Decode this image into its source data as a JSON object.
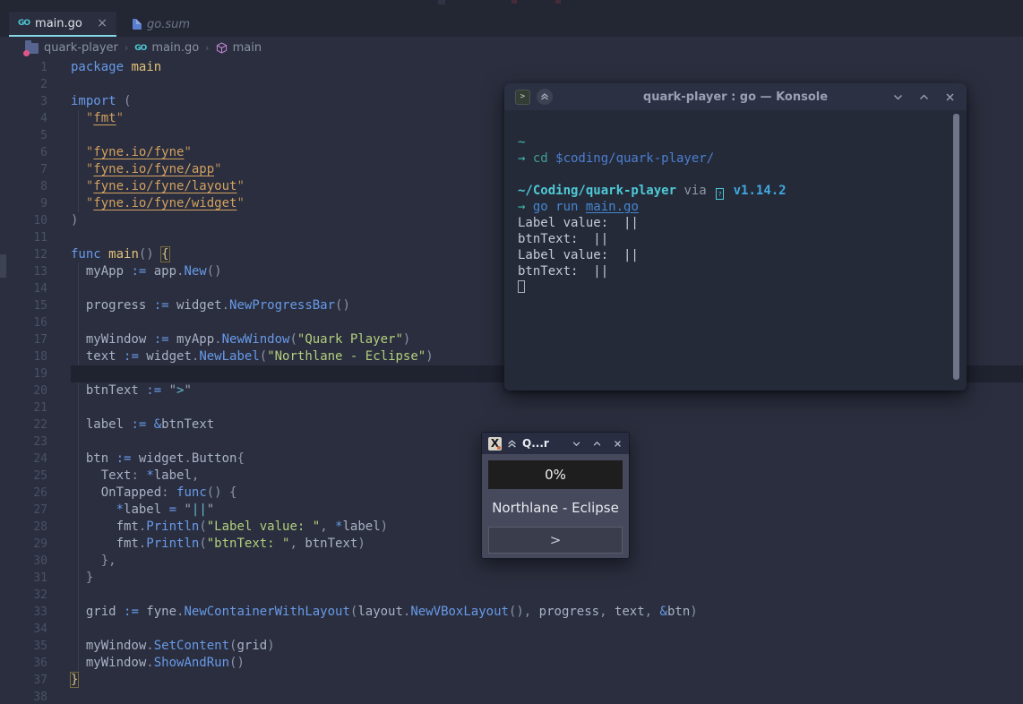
{
  "tabs": [
    {
      "label": "main.go",
      "close": "×"
    },
    {
      "label": "go.sum"
    }
  ],
  "breadcrumb": {
    "items": [
      "quark-player",
      "main.go",
      "main"
    ],
    "separator": "›"
  },
  "editor": {
    "lines": [
      {
        "n": "1",
        "t": [
          [
            "k",
            "package"
          ],
          [
            "p",
            " "
          ],
          [
            "t",
            "main"
          ]
        ]
      },
      {
        "n": "2",
        "t": []
      },
      {
        "n": "3",
        "t": [
          [
            "k",
            "import"
          ],
          [
            "p",
            " "
          ],
          [
            "u",
            "("
          ]
        ]
      },
      {
        "n": "4",
        "t": [
          [
            "p",
            "  "
          ],
          [
            "q",
            "\""
          ],
          [
            "i",
            "fmt"
          ],
          [
            "q",
            "\""
          ]
        ]
      },
      {
        "n": "5",
        "t": []
      },
      {
        "n": "6",
        "t": [
          [
            "p",
            "  "
          ],
          [
            "q",
            "\""
          ],
          [
            "i",
            "fyne.io/fyne"
          ],
          [
            "q",
            "\""
          ]
        ]
      },
      {
        "n": "7",
        "t": [
          [
            "p",
            "  "
          ],
          [
            "q",
            "\""
          ],
          [
            "i",
            "fyne.io/fyne/app"
          ],
          [
            "q",
            "\""
          ]
        ]
      },
      {
        "n": "8",
        "t": [
          [
            "p",
            "  "
          ],
          [
            "q",
            "\""
          ],
          [
            "i",
            "fyne.io/fyne/layout"
          ],
          [
            "q",
            "\""
          ]
        ]
      },
      {
        "n": "9",
        "t": [
          [
            "p",
            "  "
          ],
          [
            "q",
            "\""
          ],
          [
            "i",
            "fyne.io/fyne/widget"
          ],
          [
            "q",
            "\""
          ]
        ]
      },
      {
        "n": "10",
        "t": [
          [
            "u",
            ")"
          ]
        ]
      },
      {
        "n": "11",
        "t": []
      },
      {
        "n": "12",
        "t": [
          [
            "k",
            "func"
          ],
          [
            "p",
            " "
          ],
          [
            "t",
            "main"
          ],
          [
            "u",
            "()"
          ],
          [
            "p",
            " "
          ],
          [
            "b",
            "{"
          ]
        ]
      },
      {
        "n": "13",
        "t": [
          [
            "p",
            "  myApp "
          ],
          [
            "k",
            ":="
          ],
          [
            "p",
            " app"
          ],
          [
            "u",
            "."
          ],
          [
            "f",
            "New"
          ],
          [
            "u",
            "()"
          ]
        ]
      },
      {
        "n": "14",
        "t": []
      },
      {
        "n": "15",
        "t": [
          [
            "p",
            "  progress "
          ],
          [
            "k",
            ":="
          ],
          [
            "p",
            " widget"
          ],
          [
            "u",
            "."
          ],
          [
            "f",
            "NewProgressBar"
          ],
          [
            "u",
            "()"
          ]
        ]
      },
      {
        "n": "16",
        "t": []
      },
      {
        "n": "17",
        "t": [
          [
            "p",
            "  myWindow "
          ],
          [
            "k",
            ":="
          ],
          [
            "p",
            " myApp"
          ],
          [
            "u",
            "."
          ],
          [
            "f",
            "NewWindow"
          ],
          [
            "u",
            "("
          ],
          [
            "s",
            "\"Quark Player\""
          ],
          [
            "u",
            ")"
          ]
        ]
      },
      {
        "n": "18",
        "t": [
          [
            "p",
            "  text "
          ],
          [
            "k",
            ":="
          ],
          [
            "p",
            " widget"
          ],
          [
            "u",
            "."
          ],
          [
            "f",
            "NewLabel"
          ],
          [
            "u",
            "("
          ],
          [
            "s",
            "\"Northlane - Eclipse\""
          ],
          [
            "u",
            ")"
          ]
        ]
      },
      {
        "n": "19",
        "t": [],
        "cur": true
      },
      {
        "n": "20",
        "t": [
          [
            "p",
            "  btnText "
          ],
          [
            "k",
            ":="
          ],
          [
            "p",
            " "
          ],
          [
            "q2",
            "\""
          ],
          [
            "c",
            ">"
          ],
          [
            "q2",
            "\""
          ]
        ]
      },
      {
        "n": "21",
        "t": []
      },
      {
        "n": "22",
        "t": [
          [
            "p",
            "  label "
          ],
          [
            "k",
            ":="
          ],
          [
            "p",
            " "
          ],
          [
            "k",
            "&"
          ],
          [
            "p",
            "btnText"
          ]
        ]
      },
      {
        "n": "23",
        "t": []
      },
      {
        "n": "24",
        "t": [
          [
            "p",
            "  btn "
          ],
          [
            "k",
            ":="
          ],
          [
            "p",
            " widget"
          ],
          [
            "u",
            "."
          ],
          [
            "p",
            "Button"
          ],
          [
            "u",
            "{"
          ]
        ]
      },
      {
        "n": "25",
        "t": [
          [
            "p",
            "    Text"
          ],
          [
            "u",
            ":"
          ],
          [
            "p",
            " "
          ],
          [
            "k",
            "*"
          ],
          [
            "p",
            "label"
          ],
          [
            "u",
            ","
          ]
        ]
      },
      {
        "n": "26",
        "t": [
          [
            "p",
            "    OnTapped"
          ],
          [
            "u",
            ":"
          ],
          [
            "p",
            " "
          ],
          [
            "k",
            "func"
          ],
          [
            "u",
            "() {"
          ]
        ]
      },
      {
        "n": "27",
        "t": [
          [
            "p",
            "      "
          ],
          [
            "k",
            "*"
          ],
          [
            "p",
            "label "
          ],
          [
            "k",
            "="
          ],
          [
            "p",
            " "
          ],
          [
            "q2",
            "\""
          ],
          [
            "c",
            "||"
          ],
          [
            "q2",
            "\""
          ]
        ]
      },
      {
        "n": "28",
        "t": [
          [
            "p",
            "      fmt"
          ],
          [
            "u",
            "."
          ],
          [
            "f",
            "Println"
          ],
          [
            "u",
            "("
          ],
          [
            "s",
            "\"Label value: \""
          ],
          [
            "u",
            ", "
          ],
          [
            "k",
            "*"
          ],
          [
            "p",
            "label"
          ],
          [
            "u",
            ")"
          ]
        ]
      },
      {
        "n": "29",
        "t": [
          [
            "p",
            "      fmt"
          ],
          [
            "u",
            "."
          ],
          [
            "f",
            "Println"
          ],
          [
            "u",
            "("
          ],
          [
            "s",
            "\"btnText: \""
          ],
          [
            "u",
            ", "
          ],
          [
            "p",
            "btnText"
          ],
          [
            "u",
            ")"
          ]
        ]
      },
      {
        "n": "30",
        "t": [
          [
            "p",
            "    "
          ],
          [
            "u",
            "},"
          ]
        ]
      },
      {
        "n": "31",
        "t": [
          [
            "p",
            "  "
          ],
          [
            "u",
            "}"
          ]
        ]
      },
      {
        "n": "32",
        "t": []
      },
      {
        "n": "33",
        "t": [
          [
            "p",
            "  grid "
          ],
          [
            "k",
            ":="
          ],
          [
            "p",
            " fyne"
          ],
          [
            "u",
            "."
          ],
          [
            "f",
            "NewContainerWithLayout"
          ],
          [
            "u",
            "("
          ],
          [
            "p",
            "layout"
          ],
          [
            "u",
            "."
          ],
          [
            "f",
            "NewVBoxLayout"
          ],
          [
            "u",
            "(), "
          ],
          [
            "p",
            "progress"
          ],
          [
            "u",
            ", "
          ],
          [
            "p",
            "text"
          ],
          [
            "u",
            ", "
          ],
          [
            "k",
            "&"
          ],
          [
            "p",
            "btn"
          ],
          [
            "u",
            ")"
          ]
        ]
      },
      {
        "n": "34",
        "t": []
      },
      {
        "n": "35",
        "t": [
          [
            "p",
            "  myWindow"
          ],
          [
            "u",
            "."
          ],
          [
            "f",
            "SetContent"
          ],
          [
            "u",
            "("
          ],
          [
            "p",
            "grid"
          ],
          [
            "u",
            ")"
          ]
        ]
      },
      {
        "n": "36",
        "t": [
          [
            "p",
            "  myWindow"
          ],
          [
            "u",
            "."
          ],
          [
            "f",
            "ShowAndRun"
          ],
          [
            "u",
            "()"
          ]
        ]
      },
      {
        "n": "37",
        "t": [
          [
            "b",
            "}"
          ]
        ]
      },
      {
        "n": "38",
        "t": []
      }
    ]
  },
  "konsole": {
    "title": "quark-player : go — Konsole",
    "app_icon_glyph": ">",
    "lines": [
      {
        "t": [
          [
            "ta",
            "~"
          ]
        ]
      },
      {
        "t": [
          [
            "ta",
            "→ "
          ],
          [
            "tc",
            "cd"
          ],
          [
            "tb",
            " $coding/quark-player/"
          ]
        ]
      },
      {
        "t": []
      },
      {
        "t": [
          [
            "tp",
            "~/Coding/quark-player"
          ],
          [
            "td",
            " via "
          ],
          [
            "tg",
            "?"
          ],
          [
            "tv",
            " v1.14.2"
          ]
        ]
      },
      {
        "t": [
          [
            "ta",
            "→ "
          ],
          [
            "tr",
            "go run "
          ],
          [
            "tl",
            "main.go"
          ]
        ]
      },
      {
        "t": [
          [
            "to",
            "Label value:  ||"
          ]
        ]
      },
      {
        "t": [
          [
            "to",
            "btnText:  ||"
          ]
        ]
      },
      {
        "t": [
          [
            "to",
            "Label value:  ||"
          ]
        ]
      },
      {
        "t": [
          [
            "to",
            "btnText:  ||"
          ]
        ]
      },
      {
        "t": [],
        "cursor": true
      }
    ]
  },
  "player": {
    "title": "Q...r",
    "app_icon_glyph": "X",
    "progress_text": "0%",
    "track_label": "Northlane - Eclipse",
    "play_button": ">"
  },
  "colors": {
    "editor_bg": "#2a2e3e",
    "tabstrip_bg": "#232734",
    "accent_underline": "#86d7e6",
    "keyword_blue": "#689ae8",
    "string_green": "#b3cf7d",
    "import_orange": "#d3a15f",
    "type_yellow": "#e3c179",
    "terminal_cyan": "#4ec9d6",
    "terminal_blue": "#4487cf"
  }
}
